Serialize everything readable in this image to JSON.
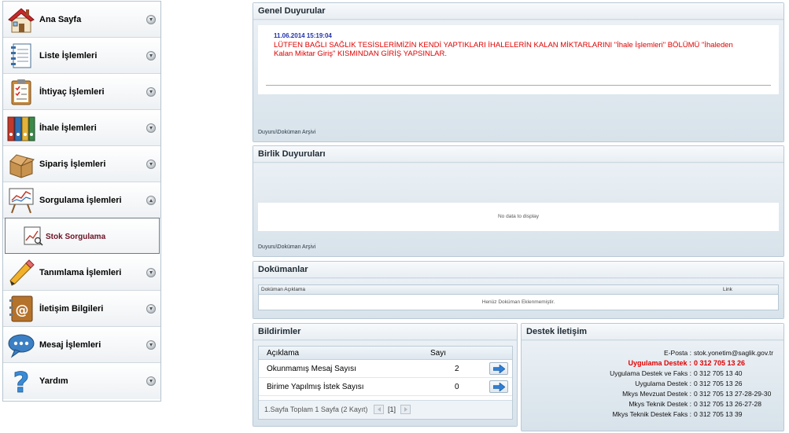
{
  "sidebar": {
    "items": [
      {
        "label": "Ana Sayfa",
        "icon": "house-icon"
      },
      {
        "label": "Liste İşlemleri",
        "icon": "notebook-icon"
      },
      {
        "label": "İhtiyaç İşlemleri",
        "icon": "clipboard-checklist-icon"
      },
      {
        "label": "İhale İşlemleri",
        "icon": "binders-icon"
      },
      {
        "label": "Sipariş İşlemleri",
        "icon": "open-box-icon"
      },
      {
        "label": "Sorgulama İşlemleri",
        "icon": "line-chart-board-icon"
      },
      {
        "label": "Tanımlama İşlemleri",
        "icon": "pencil-icon"
      },
      {
        "label": "İletişim Bilgileri",
        "icon": "address-book-icon"
      },
      {
        "label": "Mesaj İşlemleri",
        "icon": "speech-bubble-icon"
      },
      {
        "label": "Yardım",
        "icon": "question-mark-icon"
      }
    ],
    "sub_items": [
      {
        "label": "Stok Sorgulama",
        "icon": "chart-search-icon"
      }
    ]
  },
  "general_announcements": {
    "title": "Genel Duyurular",
    "date": "11.06.2014 15:19:04",
    "text": "LÜTFEN BAĞLI SAĞLIK TESİSLERİMİZİN KENDİ YAPTIKLARI İHALELERİN KALAN MİKTARLARINI \"İhale İşlemleri\" BÖLÜMÜ \"İhaleden Kalan Miktar Giriş\" KISMINDAN GİRİŞ YAPSINLAR.",
    "archive_link": "Duyuru\\Doküman Arşivi"
  },
  "union_announcements": {
    "title": "Birlik Duyuruları",
    "empty_text": "No data to display",
    "archive_link": "Duyuru\\Doküman Arşivi"
  },
  "documents": {
    "title": "Dokümanlar",
    "columns": [
      "Doküman Açıklama",
      "Link"
    ],
    "empty_text": "Henüz Doküman Eklenmemiştir."
  },
  "notifications": {
    "title": "Bildirimler",
    "columns": [
      "Açıklama",
      "Sayı"
    ],
    "rows": [
      {
        "label": "Okunmamış Mesaj Sayısı",
        "count": "2"
      },
      {
        "label": "Birime Yapılmış İstek Sayısı",
        "count": "0"
      }
    ],
    "pager_text": "1.Sayfa Toplam 1 Sayfa (2 Kayıt)",
    "pager_current": "[1]"
  },
  "support": {
    "title": "Destek İletişim",
    "lines": [
      {
        "label": "E-Posta :",
        "value": "stok.yonetim@saglik.gov.tr"
      },
      {
        "label": "Uygulama Destek :",
        "value": "0 312 705 13 26"
      },
      {
        "label": "Uygulama Destek ve Faks :",
        "value": "0 312 705 13 40"
      },
      {
        "label": "Uygulama Destek :",
        "value": "0 312 705 13 26"
      },
      {
        "label": "Mkys Mevzuat Destek :",
        "value": "0 312 705 13 27-28-29-30"
      },
      {
        "label": "Mkys Teknik Destek :",
        "value": "0 312 705 13 26-27-28"
      },
      {
        "label": "Mkys Teknik Destek Faks :",
        "value": "0 312 705 13 39"
      }
    ]
  },
  "colors": {
    "accent_red": "#e00000",
    "date_blue": "#2233aa",
    "submenu_label": "#6b1224"
  }
}
